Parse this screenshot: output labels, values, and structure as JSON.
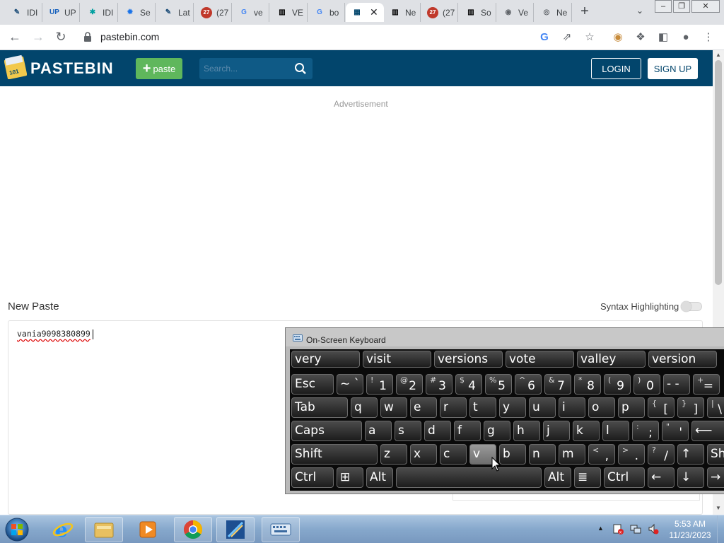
{
  "browser": {
    "tabs": [
      {
        "title": "IDI",
        "icon": "leaf-icon",
        "color": "#1e4e79"
      },
      {
        "title": "UP",
        "icon": "up-icon",
        "color": "#1560bd"
      },
      {
        "title": "IDI",
        "icon": "puzzle-icon",
        "color": "#00a0a0"
      },
      {
        "title": "Se",
        "icon": "gear-icon",
        "color": "#1a73e8"
      },
      {
        "title": "Lat",
        "icon": "leaf-icon",
        "color": "#1e4e79"
      },
      {
        "title": "(27",
        "icon": "notification-icon",
        "color": "#c0392b"
      },
      {
        "title": "ve",
        "icon": "google-icon",
        "color": "#4285f4"
      },
      {
        "title": "VE",
        "icon": "bank-icon",
        "color": "#000000"
      },
      {
        "title": "bo",
        "icon": "google-icon",
        "color": "#4285f4"
      },
      {
        "title": "",
        "icon": "pastebin-icon",
        "color": "#02456c"
      },
      {
        "title": "Ne",
        "icon": "bank-icon",
        "color": "#000000"
      },
      {
        "title": "(27",
        "icon": "notification-icon",
        "color": "#c0392b"
      },
      {
        "title": "So",
        "icon": "bank-icon",
        "color": "#000000"
      },
      {
        "title": "Ve",
        "icon": "globe-icon",
        "color": "#5f6368"
      },
      {
        "title": "Ne",
        "icon": "chrome-icon",
        "color": "#5f6368"
      }
    ],
    "notification_count": "27",
    "url": "pastebin.com"
  },
  "pastebin": {
    "brand": "PASTEBIN",
    "paste_button": "paste",
    "search_placeholder": "Search...",
    "login": "LOGIN",
    "signup": "SIGN UP",
    "advertisement": "Advertisement",
    "new_paste_heading": "New Paste",
    "syntax_highlighting": "Syntax Highlighting",
    "syntax_highlighting_on": false,
    "paste_content": "vania9098380899"
  },
  "osk": {
    "title": "On-Screen Keyboard",
    "predictions": [
      "very",
      "visit",
      "versions",
      "vote",
      "valley",
      "version"
    ],
    "rows": [
      [
        {
          "main": "Esc"
        },
        {
          "main": "~ `"
        },
        {
          "shifted": "!",
          "base": "1"
        },
        {
          "shifted": "@",
          "base": "2"
        },
        {
          "shifted": "#",
          "base": "3"
        },
        {
          "shifted": "$",
          "base": "4"
        },
        {
          "shifted": "%",
          "base": "5"
        },
        {
          "shifted": "^",
          "base": "6"
        },
        {
          "shifted": "&",
          "base": "7"
        },
        {
          "shifted": "*",
          "base": "8"
        },
        {
          "shifted": "(",
          "base": "9"
        },
        {
          "shifted": ")",
          "base": "0"
        },
        {
          "main": "- -"
        },
        {
          "shifted": "+",
          "base": "="
        }
      ],
      [
        {
          "main": "Tab"
        },
        {
          "main": "q"
        },
        {
          "main": "w"
        },
        {
          "main": "e"
        },
        {
          "main": "r"
        },
        {
          "main": "t"
        },
        {
          "main": "y"
        },
        {
          "main": "u"
        },
        {
          "main": "i"
        },
        {
          "main": "o"
        },
        {
          "main": "p"
        },
        {
          "shifted": "{",
          "base": "["
        },
        {
          "shifted": "}",
          "base": "]"
        },
        {
          "shifted": "|",
          "base": "\\"
        }
      ],
      [
        {
          "main": "Caps"
        },
        {
          "main": "a"
        },
        {
          "main": "s"
        },
        {
          "main": "d"
        },
        {
          "main": "f"
        },
        {
          "main": "g"
        },
        {
          "main": "h"
        },
        {
          "main": "j"
        },
        {
          "main": "k"
        },
        {
          "main": "l"
        },
        {
          "shifted": ":",
          "base": ";"
        },
        {
          "shifted": "\"",
          "base": "'"
        },
        {
          "main": "⟵"
        }
      ],
      [
        {
          "main": "Shift"
        },
        {
          "main": "z"
        },
        {
          "main": "x"
        },
        {
          "main": "c"
        },
        {
          "main": "v",
          "hover": true
        },
        {
          "main": "b"
        },
        {
          "main": "n"
        },
        {
          "main": "m"
        },
        {
          "shifted": "<",
          "base": ","
        },
        {
          "shifted": ">",
          "base": "."
        },
        {
          "shifted": "?",
          "base": "/"
        },
        {
          "main": "↑"
        },
        {
          "main": "Shi"
        }
      ],
      [
        {
          "main": "Ctrl"
        },
        {
          "main": "⊞",
          "icon": "windows-key-icon"
        },
        {
          "main": "Alt"
        },
        {
          "main": ""
        },
        {
          "main": "Alt"
        },
        {
          "main": "≣",
          "icon": "menu-key-icon"
        },
        {
          "main": "Ctrl"
        },
        {
          "main": "←"
        },
        {
          "main": "↓"
        },
        {
          "main": "→"
        }
      ]
    ]
  },
  "taskbar": {
    "apps": [
      "internet-explorer",
      "file-explorer",
      "media-player",
      "chrome",
      "image-app",
      "on-screen-keyboard"
    ],
    "time": "5:53 AM",
    "date": "11/23/2023"
  }
}
